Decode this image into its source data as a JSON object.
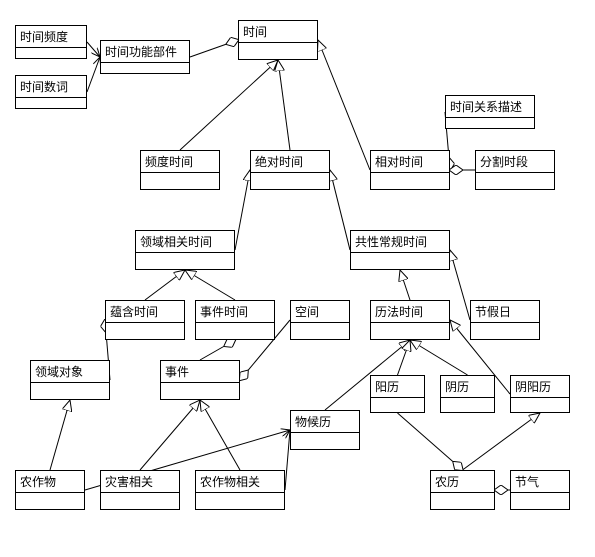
{
  "nodes": {
    "time_freq": {
      "label": "时间频度"
    },
    "time_func_part": {
      "label": "时间功能部件"
    },
    "time_numeral": {
      "label": "时间数词"
    },
    "time": {
      "label": "时间"
    },
    "time_rel_desc": {
      "label": "时间关系描述"
    },
    "freq_time": {
      "label": "频度时间"
    },
    "abs_time": {
      "label": "绝对时间"
    },
    "rel_time": {
      "label": "相对时间"
    },
    "split_period": {
      "label": "分割时段"
    },
    "domain_rel_time": {
      "label": "领域相关时间"
    },
    "common_time": {
      "label": "共性常规时间"
    },
    "implicit_time": {
      "label": "蕴含时间"
    },
    "event_time": {
      "label": "事件时间"
    },
    "space": {
      "label": "空间"
    },
    "calendar_time": {
      "label": "历法时间"
    },
    "holiday": {
      "label": "节假日"
    },
    "domain_obj": {
      "label": "领域对象"
    },
    "event": {
      "label": "事件"
    },
    "phenology": {
      "label": "物候历"
    },
    "solar_cal": {
      "label": "阳历"
    },
    "lunar_cal": {
      "label": "阴历"
    },
    "lunisolar": {
      "label": "阴阳历"
    },
    "crop": {
      "label": "农作物"
    },
    "disaster_rel": {
      "label": "灾害相关"
    },
    "crop_rel": {
      "label": "农作物相关"
    },
    "nongli": {
      "label": "农历"
    },
    "solar_term": {
      "label": "节气"
    }
  },
  "chart_data": {
    "type": "diagram",
    "edges": [
      {
        "from": "time_freq",
        "to": "time_func_part",
        "type": "assoc"
      },
      {
        "from": "time_numeral",
        "to": "time_func_part",
        "type": "assoc"
      },
      {
        "from": "time_func_part",
        "to": "time",
        "type": "agg"
      },
      {
        "from": "freq_time",
        "to": "time",
        "type": "gen"
      },
      {
        "from": "abs_time",
        "to": "time",
        "type": "gen"
      },
      {
        "from": "rel_time",
        "to": "time",
        "type": "gen"
      },
      {
        "from": "time_rel_desc",
        "to": "rel_time",
        "type": "agg"
      },
      {
        "from": "split_period",
        "to": "rel_time",
        "type": "agg"
      },
      {
        "from": "domain_rel_time",
        "to": "abs_time",
        "type": "gen"
      },
      {
        "from": "common_time",
        "to": "abs_time",
        "type": "gen"
      },
      {
        "from": "implicit_time",
        "to": "domain_rel_time",
        "type": "gen"
      },
      {
        "from": "event_time",
        "to": "domain_rel_time",
        "type": "gen"
      },
      {
        "from": "calendar_time",
        "to": "common_time",
        "type": "gen"
      },
      {
        "from": "holiday",
        "to": "common_time",
        "type": "gen"
      },
      {
        "from": "domain_obj",
        "to": "implicit_time",
        "type": "agg"
      },
      {
        "from": "event",
        "to": "event_time",
        "type": "agg"
      },
      {
        "from": "space",
        "to": "event",
        "type": "agg"
      },
      {
        "from": "phenology",
        "to": "calendar_time",
        "type": "gen"
      },
      {
        "from": "solar_cal",
        "to": "calendar_time",
        "type": "gen"
      },
      {
        "from": "lunar_cal",
        "to": "calendar_time",
        "type": "gen"
      },
      {
        "from": "lunisolar",
        "to": "calendar_time",
        "type": "gen"
      },
      {
        "from": "crop",
        "to": "domain_obj",
        "type": "gen"
      },
      {
        "from": "disaster_rel",
        "to": "event",
        "type": "gen"
      },
      {
        "from": "crop_rel",
        "to": "event",
        "type": "gen"
      },
      {
        "from": "nongli",
        "to": "lunisolar",
        "type": "gen"
      },
      {
        "from": "solar_term",
        "to": "nongli",
        "type": "agg"
      },
      {
        "from": "solar_cal",
        "to": "nongli",
        "type": "agg"
      },
      {
        "from": "crop",
        "to": "phenology",
        "type": "assoc"
      },
      {
        "from": "crop_rel",
        "to": "phenology",
        "type": "assoc"
      }
    ]
  }
}
